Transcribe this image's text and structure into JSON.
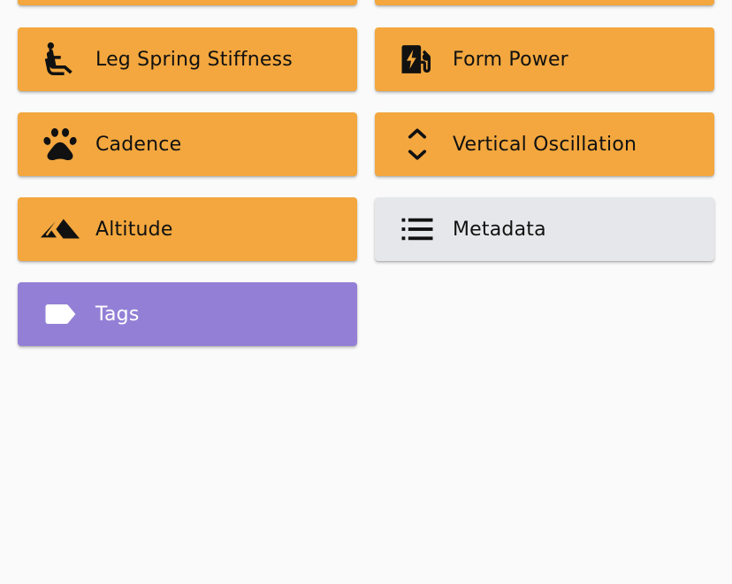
{
  "cards": [
    {
      "label": "Leg Spring Stiffness",
      "icon": "seat-recline-icon"
    },
    {
      "label": "Form Power",
      "icon": "ev-station-icon"
    },
    {
      "label": "Cadence",
      "icon": "paw-icon"
    },
    {
      "label": "Vertical Oscillation",
      "icon": "unfold-more-icon"
    },
    {
      "label": "Altitude",
      "icon": "terrain-icon"
    },
    {
      "label": "Metadata",
      "icon": "list-icon"
    },
    {
      "label": "Tags",
      "icon": "label-icon"
    }
  ],
  "colors": {
    "orange": "#f3a73e",
    "gray": "#e6e7ea",
    "purple": "#9380d6",
    "background": "#fafafa"
  }
}
